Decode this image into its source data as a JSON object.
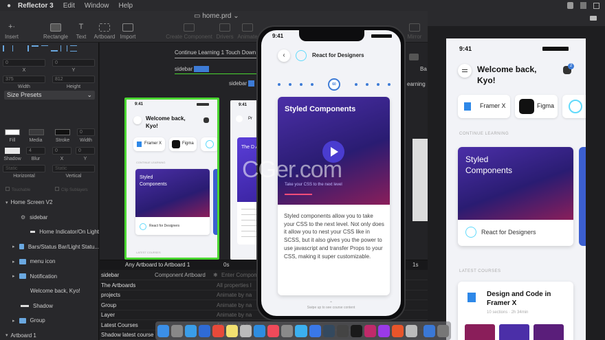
{
  "menubar": {
    "app": "Reflector 3",
    "items": [
      "Edit",
      "Window",
      "Help"
    ]
  },
  "toolbar": {
    "document": "home.prd",
    "items": [
      "Insert",
      "Rectangle",
      "Text",
      "Artboard",
      "Import",
      "Create Component",
      "Drivers",
      "Animate",
      "Mirror"
    ]
  },
  "inspector": {
    "x": "0",
    "y": "0",
    "x_label": "X",
    "y_label": "Y",
    "width": "375",
    "height": "812",
    "width_label": "Width",
    "height_label": "Height",
    "size_presets": "Size Presets",
    "fill_label": "Fill",
    "media_label": "Media",
    "stroke_label": "Stroke",
    "stroke_width": "0",
    "width_label2": "Width",
    "shadow_label": "Shadow",
    "blur": "4",
    "blur_label": "Blur",
    "sx": "0",
    "sy": "0",
    "sx_label": "X",
    "sy_label": "Y",
    "static1": "Static",
    "static2": "Static",
    "horizontal": "Horizontal",
    "vertical": "Vertical",
    "touchable": "Touchable",
    "clip": "Clip Sublayers"
  },
  "layers": [
    {
      "name": "Home Screen V2",
      "indent": 8,
      "type": "group"
    },
    {
      "name": "sidebar",
      "indent": 30,
      "type": "component"
    },
    {
      "name": "Home Indicator/On Light",
      "indent": 44,
      "type": "shape"
    },
    {
      "name": "Bars/Status Bar/Light Statu...",
      "indent": 30,
      "type": "folder"
    },
    {
      "name": "menu icon",
      "indent": 30,
      "type": "folder"
    },
    {
      "name": "Notification",
      "indent": 30,
      "type": "folder"
    },
    {
      "name": "Welcome back, Kyo!",
      "indent": 44,
      "type": "text"
    },
    {
      "name": "Shadow",
      "indent": 30,
      "type": "shape"
    },
    {
      "name": "Group",
      "indent": 30,
      "type": "folder"
    },
    {
      "name": "Artboard 1",
      "indent": 8,
      "type": "group"
    }
  ],
  "canvas": {
    "label1": "Continue Learning 1 Touch Down",
    "label2": "sidebar",
    "label3": "sidebar",
    "label4": "Ba",
    "label5": "earning"
  },
  "artboard": {
    "time": "9:41",
    "welcome": "Welcome back, Kyo!",
    "framer": "Framer X",
    "figma": "Figma",
    "continue": "CONTINUE LEARNING",
    "card": "Styled Components",
    "react": "React for Designers",
    "latest": "LATEST COURSES",
    "second_title": "The D Anon"
  },
  "timeline": {
    "header": "Any Artboard to Artboard 1",
    "t0": "0s",
    "t1": "1s",
    "rows": [
      {
        "name": "sidebar",
        "val": "Component Artboard",
        "placeholder": "Enter Compon"
      },
      {
        "name": "The Artboards",
        "val": "",
        "placeholder": "All properties l"
      },
      {
        "name": "projects",
        "val": "",
        "placeholder": "Animate by na"
      },
      {
        "name": "Group",
        "val": "",
        "placeholder": "Animate by na"
      },
      {
        "name": "Layer",
        "val": "",
        "placeholder": "Animate by na"
      },
      {
        "name": "Latest Courses",
        "val": "",
        "placeholder": "Animate by na"
      },
      {
        "name": "Shadow latest course",
        "val": "",
        "placeholder": "Animate by na"
      }
    ]
  },
  "phone": {
    "time": "9:41",
    "header": "React for Designers",
    "progress": "60",
    "card_title": "Styled Components",
    "card_sub": "Take your CSS to the next level",
    "body": "Styled components allow you to take your CSS to the next level. Not only does it allow you to nest your CSS like in SCSS, but it also gives you the power to use javascript and transfer Props to your CSS, making it super customizable.",
    "swipe": "Swipe up to see course content"
  },
  "right": {
    "time": "9:41",
    "welcome": "Welcome back, Kyo!",
    "framer": "Framer X",
    "figma": "Figma",
    "continue": "CONTINUE LEARNING",
    "card": "Styled Components",
    "react": "React for Designers",
    "latest": "LATEST COURSES",
    "course_title": "Design and Code in Framer X",
    "course_meta": "10 sections · 2h 34min",
    "badge": "2"
  },
  "watermark": "CGer.com",
  "colors": {
    "accent": "#3d7bd6",
    "selection": "#4ad631",
    "purple": "#4b2fa8",
    "react": "#61dafb"
  }
}
